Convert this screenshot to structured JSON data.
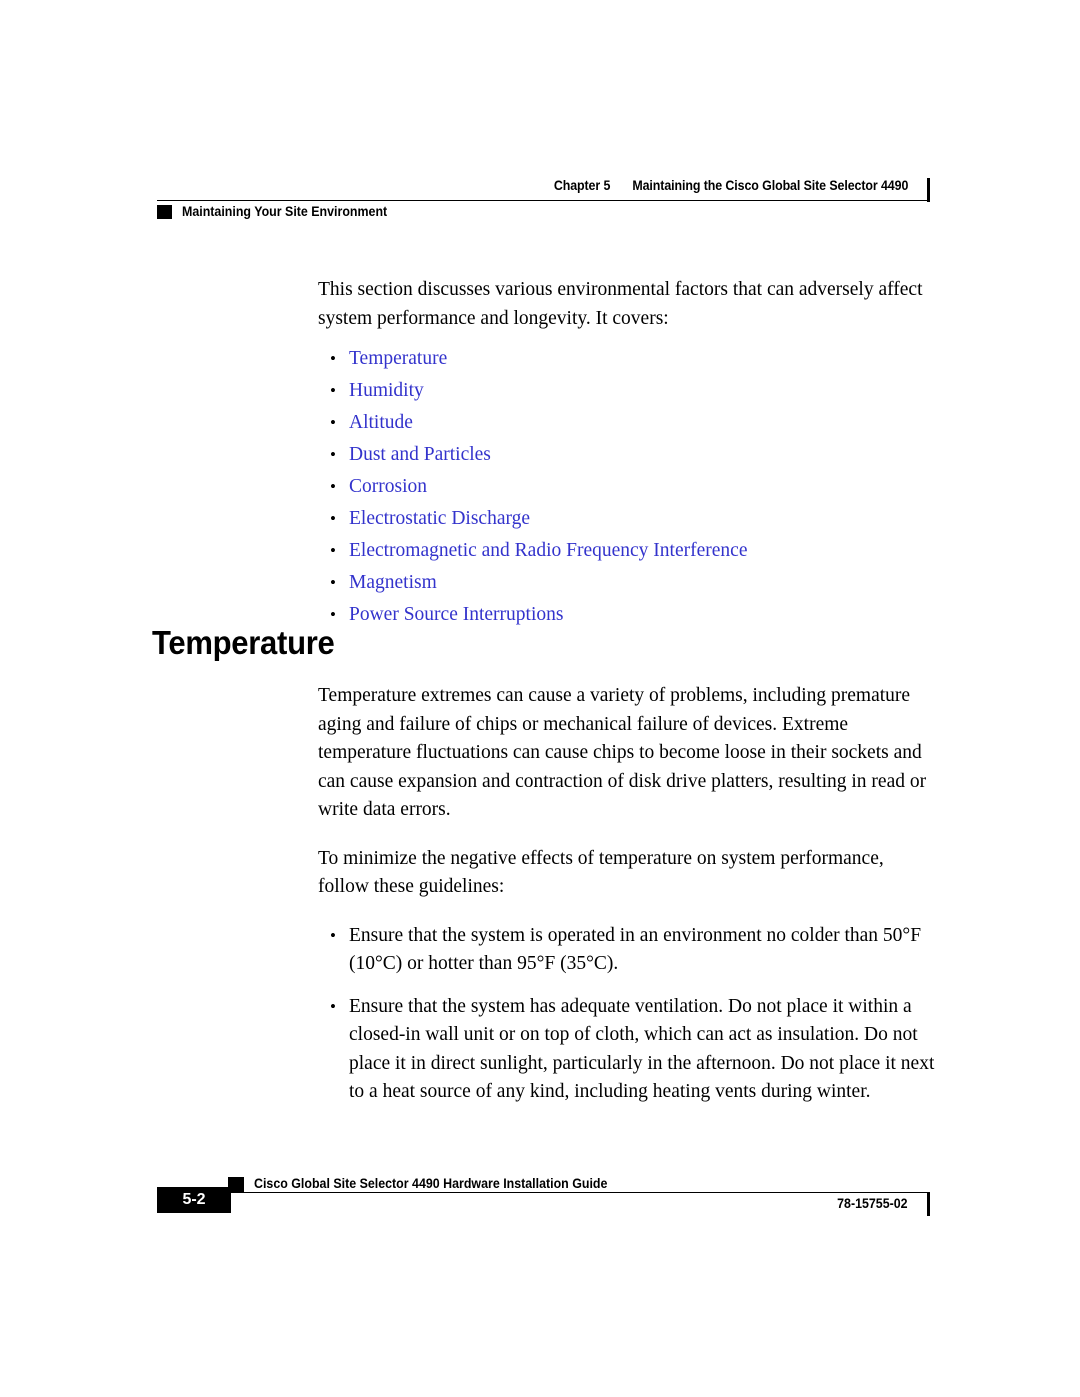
{
  "header": {
    "chapter_label": "Chapter 5",
    "chapter_title": "Maintaining the Cisco Global Site Selector 4490",
    "section_title": "Maintaining Your Site Environment"
  },
  "intro": {
    "paragraph": "This section discusses various environmental factors that can adversely affect system performance and longevity. It covers:",
    "links": [
      "Temperature",
      "Humidity",
      "Altitude",
      "Dust and Particles",
      "Corrosion",
      "Electrostatic Discharge",
      "Electromagnetic and Radio Frequency Interference",
      "Magnetism",
      "Power Source Interruptions"
    ]
  },
  "section": {
    "heading": "Temperature",
    "paragraphs": [
      "Temperature extremes can cause a variety of problems, including premature aging and failure of chips or mechanical failure of devices. Extreme temperature fluctuations can cause chips to become loose in their sockets and can cause expansion and contraction of disk drive platters, resulting in read or write data errors.",
      "To minimize the negative effects of temperature on system performance, follow these guidelines:"
    ],
    "guidelines": [
      "Ensure that the system is operated in an environment no colder than 50°F (10°C) or hotter than 95°F (35°C).",
      "Ensure that the system has adequate ventilation. Do not place it within a closed-in wall unit or on top of cloth, which can act as insulation. Do not place it in direct sunlight, particularly in the afternoon. Do not place it next to a heat source of any kind, including heating vents during winter."
    ]
  },
  "footer": {
    "page_number": "5-2",
    "guide_title": "Cisco Global Site Selector 4490 Hardware Installation Guide",
    "document_number": "78-15755-02"
  },
  "colors": {
    "link": "#3333cc",
    "text": "#000000",
    "background": "#ffffff"
  }
}
